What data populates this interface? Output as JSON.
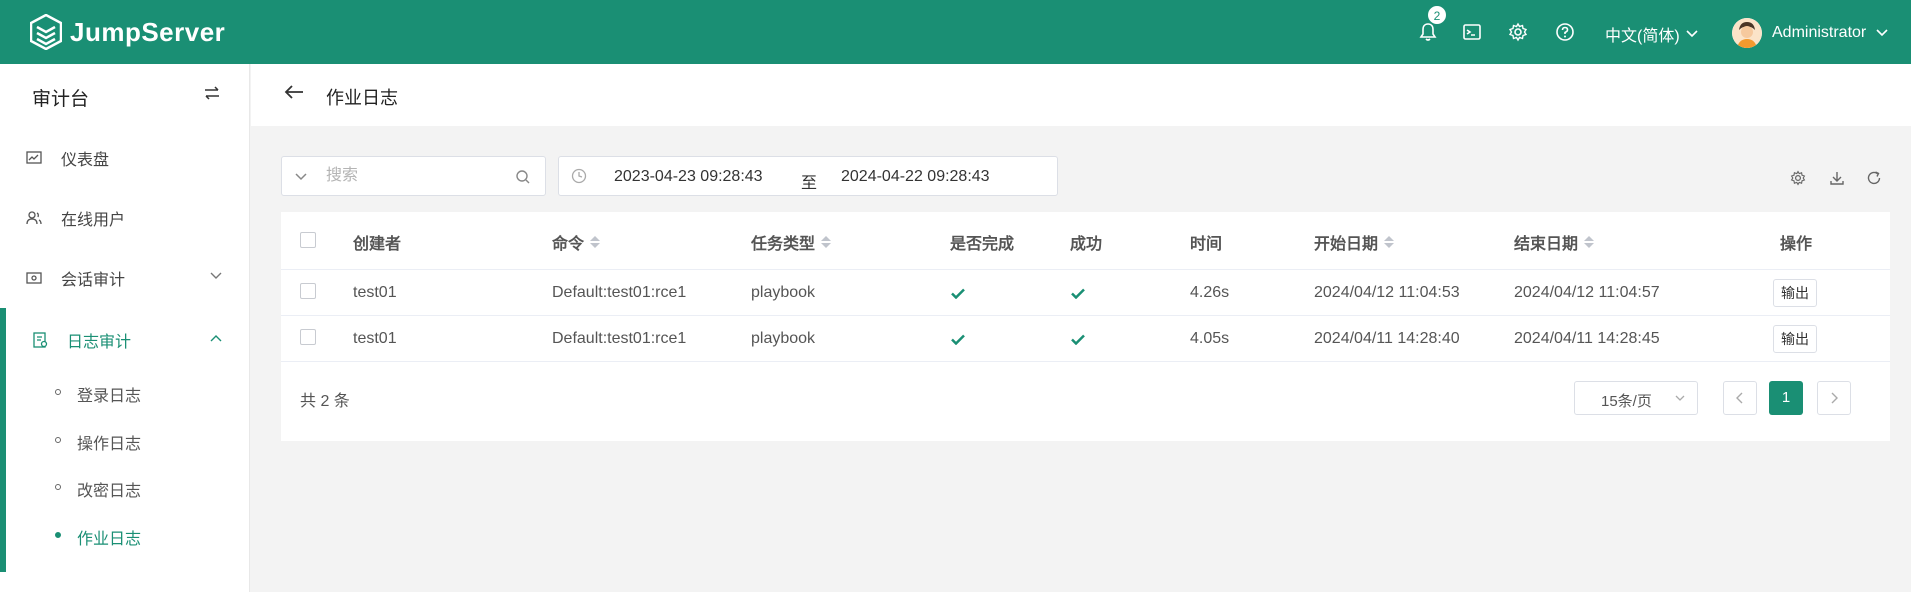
{
  "colors": {
    "brand": "#1a8f74",
    "success_check": "#1a8f74"
  },
  "header": {
    "logo_text": "JumpServer",
    "notification_count": "2",
    "language": "中文(简体)",
    "user_name": "Administrator",
    "icons": [
      "bell-icon",
      "terminal-icon",
      "gear-icon",
      "help-icon",
      "chevron-down-icon"
    ]
  },
  "sidebar": {
    "title": "审计台",
    "items": [
      {
        "label": "仪表盘",
        "icon": "dashboard-icon"
      },
      {
        "label": "在线用户",
        "icon": "users-icon"
      },
      {
        "label": "会话审计",
        "icon": "session-icon"
      },
      {
        "label": "日志审计",
        "icon": "log-icon"
      }
    ],
    "sub_items": [
      {
        "label": "登录日志"
      },
      {
        "label": "操作日志"
      },
      {
        "label": "改密日志"
      },
      {
        "label": "作业日志"
      }
    ]
  },
  "page": {
    "title": "作业日志"
  },
  "filters": {
    "search_placeholder": "搜索",
    "date_start": "2023-04-23 09:28:43",
    "date_separator": "至",
    "date_end": "2024-04-22 09:28:43"
  },
  "table": {
    "columns": [
      "创建者",
      "命令",
      "任务类型",
      "是否完成",
      "成功",
      "时间",
      "开始日期",
      "结束日期",
      "操作"
    ],
    "rows": [
      {
        "creator": "test01",
        "command": "Default:test01:rce1",
        "type": "playbook",
        "finished": true,
        "success": true,
        "time": "4.26s",
        "start": "2024/04/12 11:04:53",
        "end": "2024/04/12 11:04:57",
        "action": "输出"
      },
      {
        "creator": "test01",
        "command": "Default:test01:rce1",
        "type": "playbook",
        "finished": true,
        "success": true,
        "time": "4.05s",
        "start": "2024/04/11 14:28:40",
        "end": "2024/04/11 14:28:45",
        "action": "输出"
      }
    ]
  },
  "pagination": {
    "total_text": "共 2 条",
    "page_size": "15条/页",
    "current_page": "1"
  }
}
